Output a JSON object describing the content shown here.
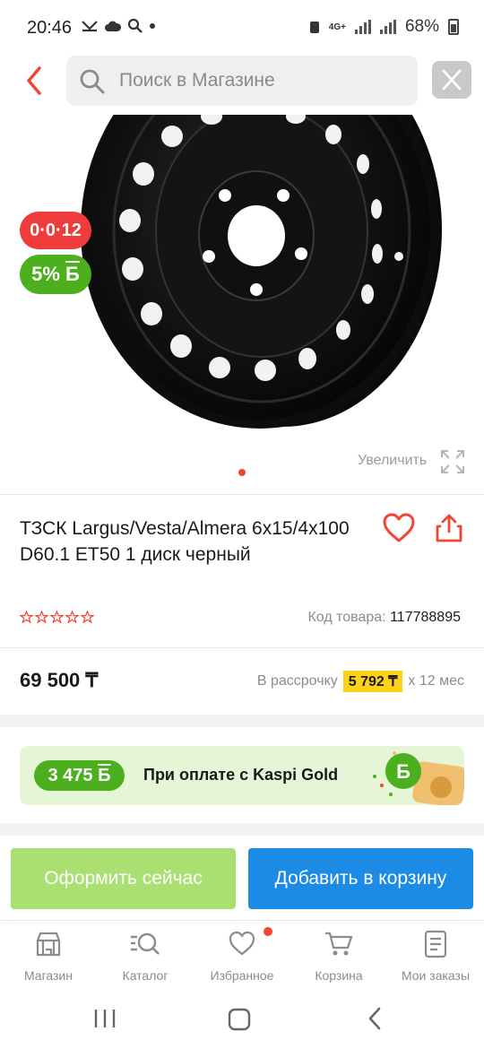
{
  "status_bar": {
    "time": "20:46",
    "network": "4G+",
    "battery": "68%"
  },
  "header": {
    "search_placeholder": "Поиск в Магазине"
  },
  "hero": {
    "badge_installment": "0·0·12",
    "badge_bonus": "5%",
    "badge_bonus_symbol": "Б",
    "zoom_label": "Увеличить"
  },
  "product": {
    "title": "ТЗСК Largus/Vesta/Almera 6x15/4x100 D60.1 ET50 1 диск черный",
    "rating_stars": 0,
    "code_label": "Код товара:",
    "code_value": "117788895",
    "price": "69 500 ₸",
    "installment_label": "В рассрочку",
    "installment_amount": "5 792 ₸",
    "installment_term": "х 12 мес"
  },
  "bonus": {
    "amount": "3 475",
    "symbol": "Б",
    "text": "При оплате с Kaspi Gold"
  },
  "actions": {
    "buy_now": "Оформить сейчас",
    "add_to_cart": "Добавить в корзину"
  },
  "tabs": [
    {
      "label": "Магазин",
      "icon": "shop-icon"
    },
    {
      "label": "Каталог",
      "icon": "catalog-icon"
    },
    {
      "label": "Избранное",
      "icon": "heart-icon"
    },
    {
      "label": "Корзина",
      "icon": "cart-icon"
    },
    {
      "label": "Мои заказы",
      "icon": "orders-icon"
    }
  ],
  "colors": {
    "accent_red": "#f14635",
    "bonus_green": "#4caf1e",
    "cart_blue": "#1b8be6",
    "buy_now_green": "#a9e071",
    "installment_yellow": "#ffd21a"
  }
}
